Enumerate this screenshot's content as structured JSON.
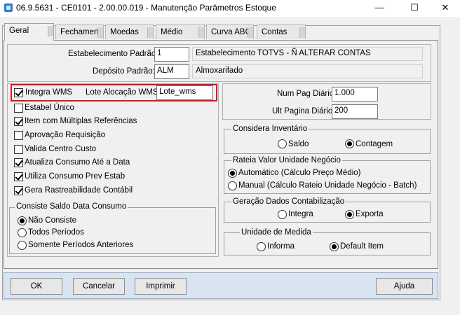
{
  "window": {
    "title": "06.9.5631 - CE0101 - 2.00.00.019 - Manutenção Parâmetros Estoque",
    "minimize_glyph": "—",
    "maximize_glyph": "☐",
    "close_glyph": "✕"
  },
  "tabs": [
    {
      "label": "Geral",
      "active": true
    },
    {
      "label": "Fechamento"
    },
    {
      "label": "Moedas"
    },
    {
      "label": "Médio"
    },
    {
      "label": "Curva ABC"
    },
    {
      "label": "Contas"
    }
  ],
  "header": {
    "estabelecimento_label": "Estabelecimento Padrão:",
    "estabelecimento_value": "1",
    "estabelecimento_desc": "Estabelecimento TOTVS - Ñ ALTERAR CONTAS",
    "deposito_label": "Depósito Padrão:",
    "deposito_value": "ALM",
    "deposito_desc": "Almoxarifado"
  },
  "left": {
    "integra_wms": {
      "label": "Integra WMS",
      "checked": true
    },
    "lote_label": "Lote Alocação WMS:",
    "lote_value": "Lote_wms",
    "checkboxes": [
      {
        "label": "Estabel Único",
        "checked": false
      },
      {
        "label": "Item com Múltiplas Referências",
        "checked": true
      },
      {
        "label": "Aprovação Requisição",
        "checked": false
      },
      {
        "label": "Valida Centro Custo",
        "checked": false
      },
      {
        "label": "Atualiza Consumo Até a Data",
        "checked": true
      },
      {
        "label": "Utiliza Consumo Prev Estab",
        "checked": true
      },
      {
        "label": "Gera Rastreabilidade Contábil",
        "checked": true
      }
    ],
    "consiste": {
      "title": "Consiste Saldo Data Consumo",
      "options": [
        {
          "label": "Não Consiste",
          "selected": true
        },
        {
          "label": "Todos Períodos",
          "selected": false
        },
        {
          "label": "Somente Períodos Anteriores",
          "selected": false
        }
      ]
    }
  },
  "right": {
    "num_pag_label": "Num Pag Diário:",
    "num_pag_value": "1.000",
    "ult_pag_label": "Ult Pagina Diário:",
    "ult_pag_value": "200",
    "inventario": {
      "title": "Considera Inventário",
      "options": [
        {
          "label": "Saldo",
          "selected": false
        },
        {
          "label": "Contagem",
          "selected": true
        }
      ]
    },
    "rateio": {
      "title": "Rateia Valor Unidade Negócio",
      "options": [
        {
          "label": "Automático (Cálculo Preço Médio)",
          "selected": true
        },
        {
          "label": "Manual (Cálculo Rateio Unidade Negócio - Batch)",
          "selected": false
        }
      ]
    },
    "contabilizacao": {
      "title": "Geração Dados Contabilização",
      "options": [
        {
          "label": "Integra",
          "selected": false
        },
        {
          "label": "Exporta",
          "selected": true
        }
      ]
    },
    "unidade": {
      "title": "Unidade de Medida",
      "options": [
        {
          "label": "Informa",
          "selected": false
        },
        {
          "label": "Default Item",
          "selected": true
        }
      ]
    }
  },
  "buttons": {
    "ok": "OK",
    "cancelar": "Cancelar",
    "imprimir": "Imprimir",
    "ajuda": "Ajuda"
  },
  "colors": {
    "highlight": "#e0141e",
    "button_bar": "#d9e4f1"
  }
}
